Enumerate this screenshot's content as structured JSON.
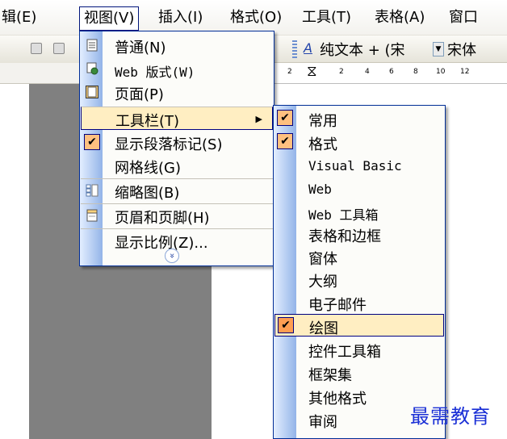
{
  "menubar": {
    "items": [
      {
        "label": "辑(E)"
      },
      {
        "label": "视图(V)"
      },
      {
        "label": "插入(I)"
      },
      {
        "label": "格式(O)"
      },
      {
        "label": "工具(T)"
      },
      {
        "label": "表格(A)"
      },
      {
        "label": "窗口"
      }
    ]
  },
  "toolbar": {
    "style_name": "纯文本 + (宋",
    "font_name": "宋体"
  },
  "ruler": {
    "ticks": [
      "2",
      "2",
      "4",
      "6",
      "8",
      "10",
      "12"
    ]
  },
  "view_menu": {
    "items": [
      {
        "label": "普通(N)",
        "icon": "normal-view-icon"
      },
      {
        "label": "Web 版式(W)",
        "icon": "web-layout-icon"
      },
      {
        "label": "页面(P)",
        "icon": "page-layout-icon"
      },
      {
        "label": "工具栏(T)",
        "submenu_arrow": "▶"
      },
      {
        "label": "显示段落标记(S)",
        "checked": true
      },
      {
        "label": "网格线(G)"
      },
      {
        "label": "缩略图(B)",
        "icon": "thumbnail-icon"
      },
      {
        "label": "页眉和页脚(H)",
        "icon": "header-footer-icon"
      },
      {
        "label": "显示比例(Z)..."
      }
    ],
    "expand_glyph": "»"
  },
  "toolbars_menu": {
    "items": [
      {
        "label": "常用",
        "checked": true
      },
      {
        "label": "格式",
        "checked": true
      },
      {
        "label": "Visual Basic"
      },
      {
        "label": "Web"
      },
      {
        "label": "Web 工具箱"
      },
      {
        "label": "表格和边框"
      },
      {
        "label": "窗体"
      },
      {
        "label": "大纲"
      },
      {
        "label": "电子邮件"
      },
      {
        "label": "绘图",
        "checked": true,
        "highlighted": true
      },
      {
        "label": "控件工具箱"
      },
      {
        "label": "框架集"
      },
      {
        "label": "其他格式"
      },
      {
        "label": "审阅"
      }
    ]
  },
  "check_glyph": "✔",
  "watermark": "最需教育",
  "colors": {
    "menu_border": "#002d96",
    "highlight": "#ffeec2",
    "check_bg": "#ffc080",
    "gutter_start": "#e3eeff",
    "gutter_end": "#93b4e8",
    "watermark": "#1a2fd6"
  }
}
